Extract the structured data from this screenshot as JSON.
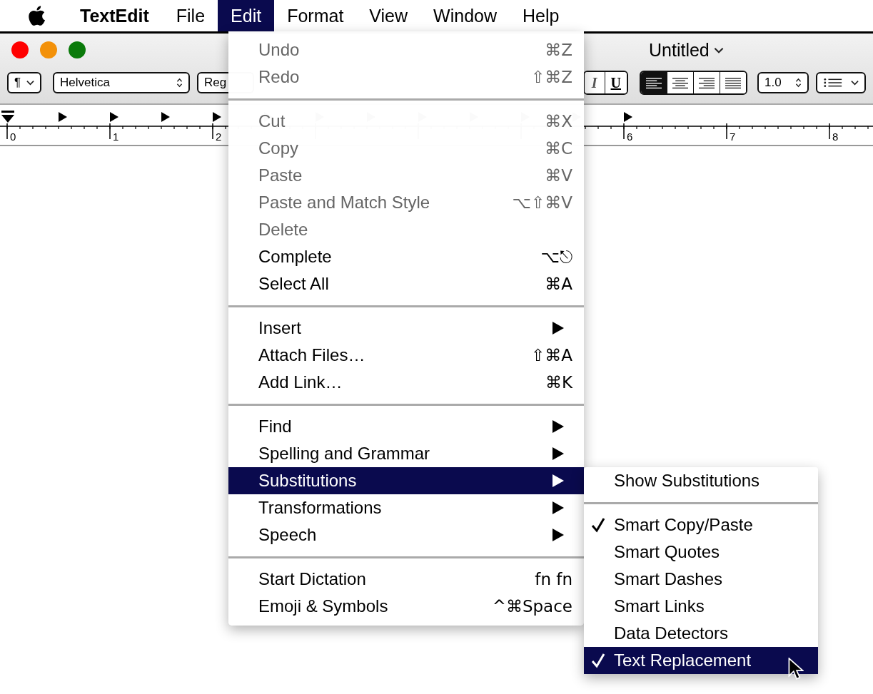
{
  "menubar": [
    {
      "label": "TextEdit",
      "kind": "app",
      "selected": false
    },
    {
      "label": "File",
      "kind": "menu",
      "selected": false
    },
    {
      "label": "Edit",
      "kind": "menu",
      "selected": true
    },
    {
      "label": "Format",
      "kind": "menu",
      "selected": false
    },
    {
      "label": "View",
      "kind": "menu",
      "selected": false
    },
    {
      "label": "Window",
      "kind": "menu",
      "selected": false
    },
    {
      "label": "Help",
      "kind": "menu",
      "selected": false
    }
  ],
  "window": {
    "title": "Untitled",
    "toolbar": {
      "paragraph_popup": "¶",
      "font_popup": "Helvetica",
      "style_popup": "Reg",
      "italic_button": "I",
      "underline_button": "U",
      "alignments": [
        {
          "kind": "left",
          "selected": true
        },
        {
          "kind": "center",
          "selected": false
        },
        {
          "kind": "right",
          "selected": false
        },
        {
          "kind": "justify",
          "selected": false
        }
      ],
      "spacing_popup": "1.0"
    },
    "ruler": {
      "left_labels": [
        "0",
        "1",
        "2"
      ],
      "right_labels": [
        "6",
        "7",
        "8"
      ]
    }
  },
  "edit_menu": [
    {
      "kind": "item",
      "label": "Undo",
      "shortcut": "⌘Z",
      "disabled": true,
      "has_submenu": false,
      "selected": false
    },
    {
      "kind": "item",
      "label": "Redo",
      "shortcut": "⇧⌘Z",
      "disabled": true,
      "has_submenu": false,
      "selected": false
    },
    {
      "kind": "separator"
    },
    {
      "kind": "item",
      "label": "Cut",
      "shortcut": "⌘X",
      "disabled": true,
      "has_submenu": false,
      "selected": false
    },
    {
      "kind": "item",
      "label": "Copy",
      "shortcut": "⌘C",
      "disabled": true,
      "has_submenu": false,
      "selected": false
    },
    {
      "kind": "item",
      "label": "Paste",
      "shortcut": "⌘V",
      "disabled": true,
      "has_submenu": false,
      "selected": false
    },
    {
      "kind": "item",
      "label": "Paste and Match Style",
      "shortcut": "⌥⇧⌘V",
      "disabled": true,
      "has_submenu": false,
      "selected": false
    },
    {
      "kind": "item",
      "label": "Delete",
      "disabled": true,
      "has_submenu": false,
      "selected": false
    },
    {
      "kind": "item",
      "label": "Complete",
      "shortcut": "⌥⎋",
      "disabled": false,
      "has_submenu": false,
      "selected": false
    },
    {
      "kind": "item",
      "label": "Select All",
      "shortcut": "⌘A",
      "disabled": false,
      "has_submenu": false,
      "selected": false
    },
    {
      "kind": "separator"
    },
    {
      "kind": "item",
      "label": "Insert",
      "disabled": false,
      "has_submenu": true,
      "selected": false
    },
    {
      "kind": "item",
      "label": "Attach Files…",
      "shortcut": "⇧⌘A",
      "disabled": false,
      "has_submenu": false,
      "selected": false
    },
    {
      "kind": "item",
      "label": "Add Link…",
      "shortcut": "⌘K",
      "disabled": false,
      "has_submenu": false,
      "selected": false
    },
    {
      "kind": "separator"
    },
    {
      "kind": "item",
      "label": "Find",
      "disabled": false,
      "has_submenu": true,
      "selected": false
    },
    {
      "kind": "item",
      "label": "Spelling and Grammar",
      "disabled": false,
      "has_submenu": true,
      "selected": false
    },
    {
      "kind": "item",
      "label": "Substitutions",
      "disabled": false,
      "has_submenu": true,
      "selected": true
    },
    {
      "kind": "item",
      "label": "Transformations",
      "disabled": false,
      "has_submenu": true,
      "selected": false
    },
    {
      "kind": "item",
      "label": "Speech",
      "disabled": false,
      "has_submenu": true,
      "selected": false
    },
    {
      "kind": "separator"
    },
    {
      "kind": "item",
      "label": "Start Dictation",
      "shortcut": "fn fn",
      "disabled": false,
      "has_submenu": false,
      "selected": false
    },
    {
      "kind": "item",
      "label": "Emoji & Symbols",
      "shortcut": "^⌘Space",
      "disabled": false,
      "has_submenu": false,
      "selected": false
    }
  ],
  "substitutions_menu": [
    {
      "kind": "item",
      "label": "Show Substitutions",
      "checked": false,
      "selected": false
    },
    {
      "kind": "separator"
    },
    {
      "kind": "item",
      "label": "Smart Copy/Paste",
      "checked": true,
      "selected": false
    },
    {
      "kind": "item",
      "label": "Smart Quotes",
      "checked": false,
      "selected": false
    },
    {
      "kind": "item",
      "label": "Smart Dashes",
      "checked": false,
      "selected": false
    },
    {
      "kind": "item",
      "label": "Smart Links",
      "checked": false,
      "selected": false
    },
    {
      "kind": "item",
      "label": "Data Detectors",
      "checked": false,
      "selected": false
    },
    {
      "kind": "item",
      "label": "Text Replacement",
      "checked": true,
      "selected": true
    }
  ]
}
